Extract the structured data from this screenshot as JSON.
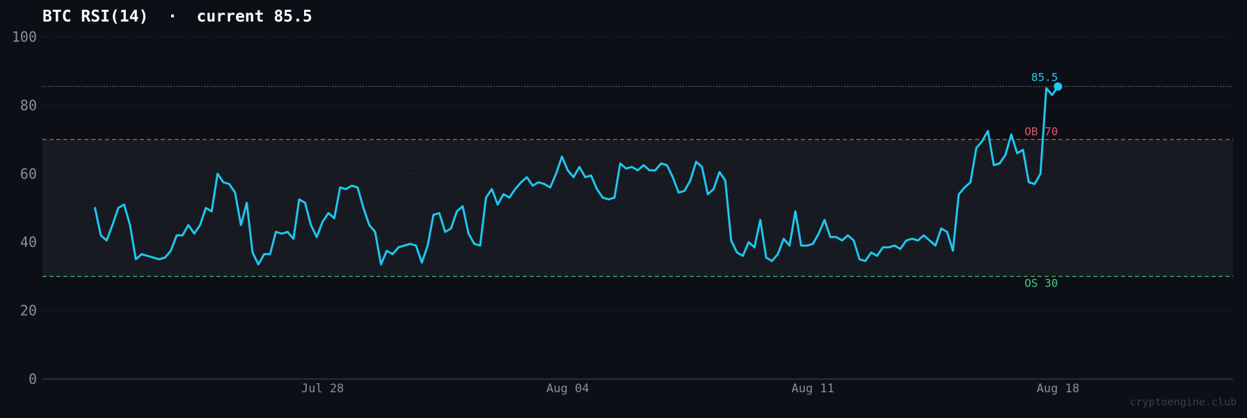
{
  "chart_data": {
    "type": "line",
    "title": "BTC RSI(14)  ·  current 85.5",
    "ylim": [
      0,
      100
    ],
    "yticks": [
      0,
      20,
      40,
      60,
      80,
      100
    ],
    "x_range": [
      "2025-07-20",
      "2025-08-23"
    ],
    "xticks": [
      {
        "date": "2025-07-28",
        "label": "Jul 28"
      },
      {
        "date": "2025-08-04",
        "label": "Aug 04"
      },
      {
        "date": "2025-08-11",
        "label": "Aug 11"
      },
      {
        "date": "2025-08-18",
        "label": "Aug 18"
      }
    ],
    "grid": true,
    "overbought": {
      "value": 70,
      "label": "OB 70"
    },
    "oversold": {
      "value": 30,
      "label": "OS 30"
    },
    "current": {
      "value": 85.5,
      "label": "85.5"
    },
    "series": [
      {
        "color": "#1ec8f0",
        "start": "2025-07-21T12:00",
        "step_hours": 4,
        "values": [
          50,
          42,
          40.5,
          45,
          50,
          51,
          45,
          35,
          36.5,
          36,
          35.5,
          35,
          35.5,
          37.5,
          42,
          42,
          45,
          42.5,
          45,
          50,
          49,
          60,
          57.5,
          57,
          54.5,
          45,
          51.5,
          37,
          33.5,
          36.5,
          36.5,
          43,
          42.5,
          43,
          41,
          52.5,
          51.5,
          45,
          41.5,
          46,
          48.5,
          47,
          56,
          55.5,
          56.5,
          56,
          50,
          45,
          43,
          33.5,
          37.5,
          36.5,
          38.5,
          39,
          39.5,
          39,
          34,
          39,
          48,
          48.5,
          43,
          44,
          49,
          50.5,
          42.5,
          39.5,
          39,
          53,
          55.5,
          51,
          54,
          53,
          55.5,
          57.5,
          59,
          56.5,
          57.5,
          57,
          56,
          60,
          65,
          61,
          59,
          62,
          59,
          59.5,
          55.5,
          53,
          52.5,
          53,
          63,
          61.5,
          62,
          61,
          62.5,
          61,
          61,
          63,
          62.5,
          59,
          54.5,
          55,
          58,
          63.5,
          62,
          54,
          55.5,
          60.5,
          58,
          40.5,
          37,
          36,
          40,
          38.5,
          46.5,
          35.5,
          34.5,
          36.5,
          41,
          39,
          49,
          39,
          39,
          39.5,
          42.5,
          46.5,
          41.5,
          41.5,
          40.5,
          42,
          40.5,
          35,
          34.5,
          37,
          36,
          38.5,
          38.5,
          39,
          38,
          40.5,
          41,
          40.5,
          42,
          40.5,
          39,
          44,
          43,
          37.5,
          54,
          56,
          57.5,
          67.5,
          69.5,
          72.5,
          62.5,
          63,
          65.5,
          71.5,
          66,
          67,
          57.5,
          57,
          60,
          85,
          83,
          85.5
        ]
      }
    ],
    "watermark": "cryptoengine.club"
  }
}
